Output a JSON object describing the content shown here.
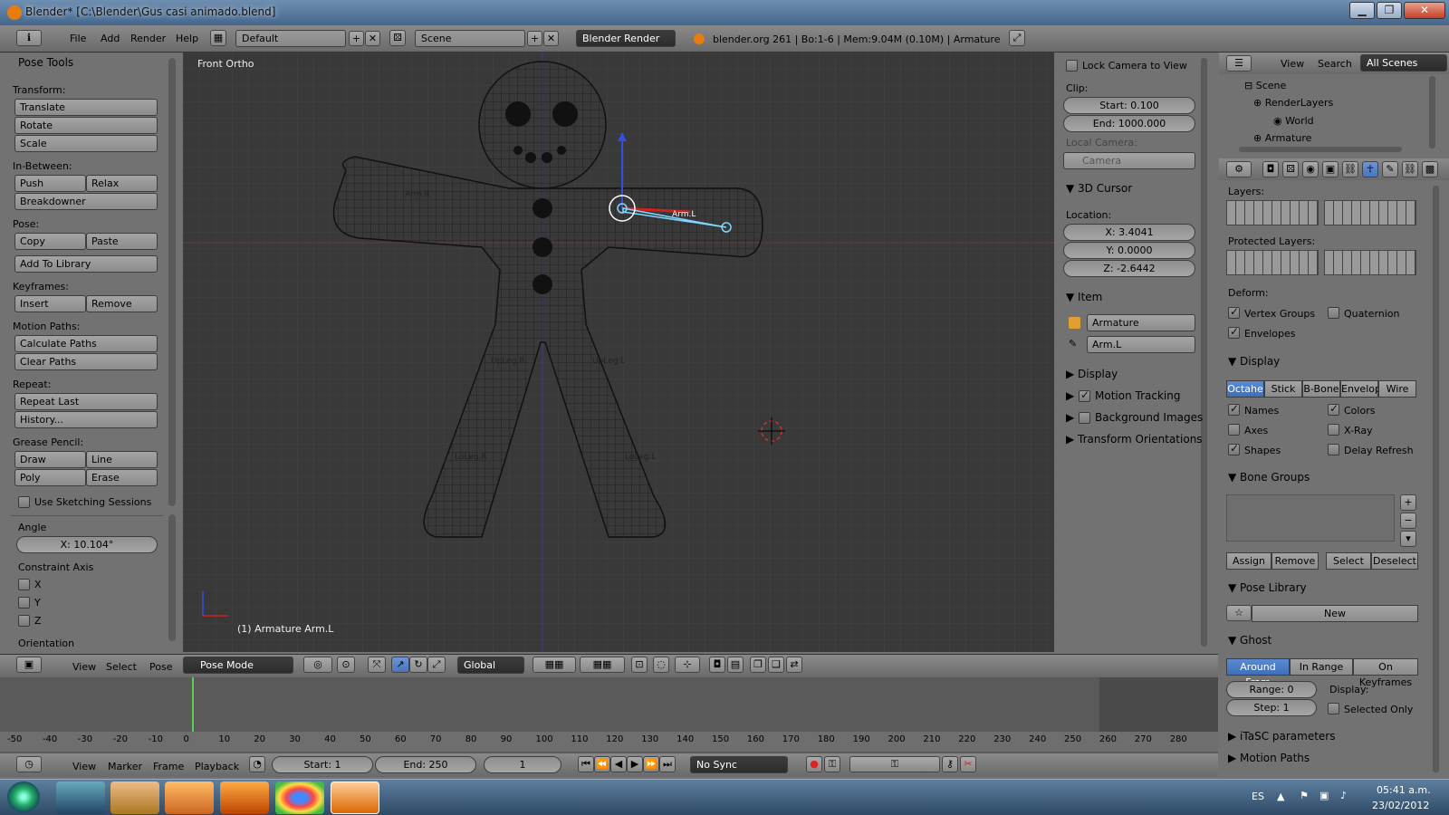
{
  "window": {
    "title": "Blender* [C:\\Blender\\Gus casi animado.blend]",
    "minimize": "▁",
    "maximize": "❐",
    "close": "✕"
  },
  "info_header": {
    "menus": [
      "File",
      "Add",
      "Render",
      "Help"
    ],
    "screen_layout": "Default",
    "scene": "Scene",
    "render_engine": "Blender Render",
    "stats": "blender.org 261 | Bo:1-6 | Mem:9.04M (0.10M) | Armature"
  },
  "toolshelf": {
    "title": "Pose Tools",
    "transform": {
      "label": "Transform:",
      "translate": "Translate",
      "rotate": "Rotate",
      "scale": "Scale"
    },
    "inbetween": {
      "label": "In-Between:",
      "push": "Push",
      "relax": "Relax",
      "breakdowner": "Breakdowner"
    },
    "pose": {
      "label": "Pose:",
      "copy": "Copy",
      "paste": "Paste",
      "add_to_library": "Add To Library"
    },
    "keyframes": {
      "label": "Keyframes:",
      "insert": "Insert",
      "remove": "Remove"
    },
    "motion_paths": {
      "label": "Motion Paths:",
      "calculate": "Calculate Paths",
      "clear": "Clear Paths"
    },
    "repeat": {
      "label": "Repeat:",
      "repeat_last": "Repeat Last",
      "history": "History..."
    },
    "grease_pencil": {
      "label": "Grease Pencil:",
      "draw": "Draw",
      "line": "Line",
      "poly": "Poly",
      "erase": "Erase",
      "sketching": "Use Sketching Sessions"
    },
    "operator": {
      "angle_label": "Angle",
      "angle_value": "X: 10.104°",
      "constraint_label": "Constraint Axis",
      "x": "X",
      "y": "Y",
      "z": "Z",
      "orientation": "Orientation"
    }
  },
  "viewport": {
    "view_name": "Front Ortho",
    "selection_text": "(1) Armature Arm.L",
    "bone_labels": [
      "Arm.R",
      "Arm.L",
      "UpLeg.R",
      "UpLeg.L",
      "LoLeg.R",
      "LoLeg.L"
    ]
  },
  "npanel": {
    "lock_camera": "Lock Camera to View",
    "clip_label": "Clip:",
    "clip_start": "Start: 0.100",
    "clip_end": "End: 1000.000",
    "local_camera_label": "Local Camera:",
    "camera": "Camera",
    "cursor_title": "3D Cursor",
    "location_label": "Location:",
    "x": "X: 3.4041",
    "y": "Y: 0.0000",
    "z": "Z: -2.6442",
    "item_title": "Item",
    "item_object": "Armature",
    "item_bone": "Arm.L",
    "display": "Display",
    "motion_tracking": "Motion Tracking",
    "background_images": "Background Images",
    "transform_orientations": "Transform Orientations"
  },
  "view3d_header": {
    "menus": [
      "View",
      "Select",
      "Pose"
    ],
    "mode": "Pose Mode",
    "orientation": "Global"
  },
  "timeline": {
    "ticks": [
      "-50",
      "-40",
      "-30",
      "-20",
      "-10",
      "0",
      "10",
      "20",
      "30",
      "40",
      "50",
      "60",
      "70",
      "80",
      "90",
      "100",
      "110",
      "120",
      "130",
      "140",
      "150",
      "160",
      "170",
      "180",
      "190",
      "200",
      "210",
      "220",
      "230",
      "240",
      "250",
      "260",
      "270",
      "280"
    ],
    "menus": [
      "View",
      "Marker",
      "Frame",
      "Playback"
    ],
    "start": "Start: 1",
    "end": "End: 250",
    "current": "1",
    "sync": "No Sync",
    "current_frame": 1
  },
  "outliner": {
    "menus": [
      "View",
      "Search"
    ],
    "filter": "All Scenes",
    "items": [
      "Scene",
      "RenderLayers",
      "World",
      "Armature"
    ]
  },
  "properties": {
    "layers_label": "Layers:",
    "protected_label": "Protected Layers:",
    "deform_label": "Deform:",
    "vertex_groups": "Vertex Groups",
    "quaternion": "Quaternion",
    "envelopes": "Envelopes",
    "display_title": "Display",
    "display_modes": [
      "Octahe",
      "Stick",
      "B-Bone",
      "Envelop",
      "Wire"
    ],
    "names": "Names",
    "colors": "Colors",
    "axes": "Axes",
    "xray": "X-Ray",
    "shapes": "Shapes",
    "delay_refresh": "Delay Refresh",
    "bone_groups_title": "Bone Groups",
    "assign": "Assign",
    "remove": "Remove",
    "select": "Select",
    "deselect": "Deselect",
    "pose_library_title": "Pose Library",
    "new": "New",
    "ghost_title": "Ghost",
    "ghost_modes": [
      "Around Fram",
      "In Range",
      "On Keyframes"
    ],
    "range": "Range: 0",
    "step": "Step: 1",
    "display_label": "Display:",
    "selected_only": "Selected Only",
    "itasc": "iTaSC parameters",
    "motion_paths": "Motion Paths"
  },
  "taskbar": {
    "language": "ES",
    "time": "05:41 a.m.",
    "date": "23/02/2012"
  }
}
